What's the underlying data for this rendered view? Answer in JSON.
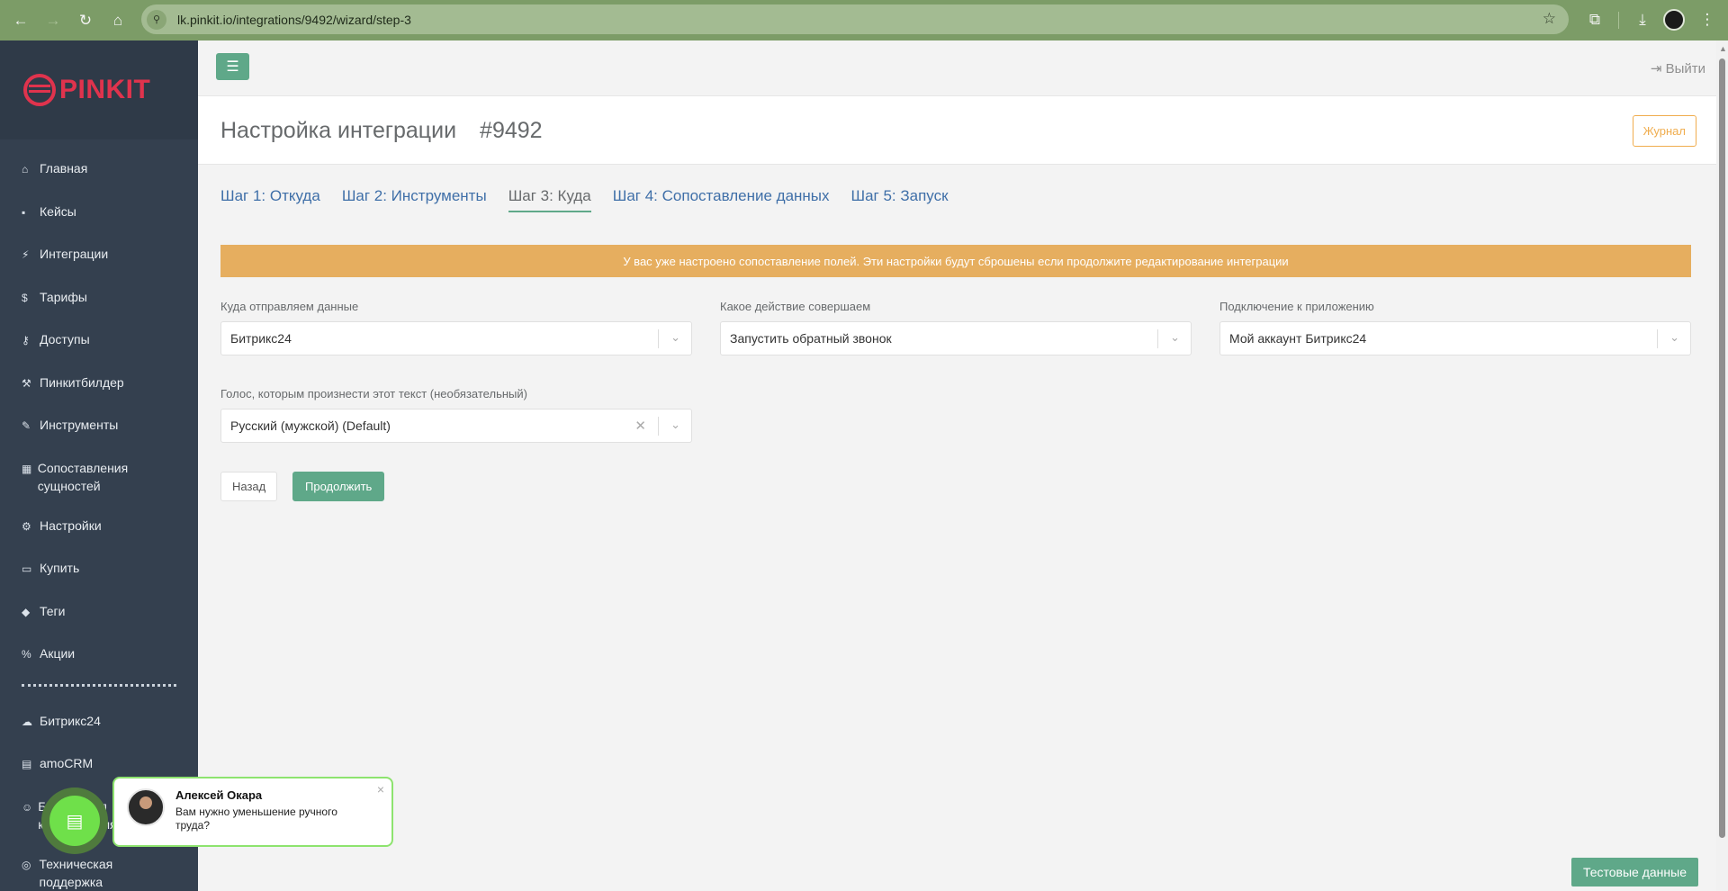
{
  "browser": {
    "url": "lk.pinkit.io/integrations/9492/wizard/step-3"
  },
  "sidebar": {
    "logo": "PINKIT",
    "items": [
      {
        "label": "Главная",
        "icon": "home-icon",
        "glyph": "⌂"
      },
      {
        "label": "Кейсы",
        "icon": "briefcase-icon",
        "glyph": "▪"
      },
      {
        "label": "Интеграции",
        "icon": "plug-icon",
        "glyph": "⚡"
      },
      {
        "label": "Тарифы",
        "icon": "dollar-icon",
        "glyph": "$"
      },
      {
        "label": "Доступы",
        "icon": "key-icon",
        "glyph": "⚷"
      },
      {
        "label": "Пинкитбилдер",
        "icon": "hammer-icon",
        "glyph": "⚒"
      },
      {
        "label": "Инструменты",
        "icon": "wrench-icon",
        "glyph": "✎"
      },
      {
        "label": "Сопоставления сущностей",
        "icon": "table-icon",
        "glyph": "▦"
      },
      {
        "label": "Настройки",
        "icon": "gears-icon",
        "glyph": "⚙"
      },
      {
        "label": "Купить",
        "icon": "money-icon",
        "glyph": "▭"
      },
      {
        "label": "Теги",
        "icon": "tags-icon",
        "glyph": "◆"
      },
      {
        "label": "Акции",
        "icon": "percent-icon",
        "glyph": "%"
      },
      {
        "label": "Битрикс24",
        "icon": "cloud-icon",
        "glyph": "☁"
      },
      {
        "label": "amoCRM",
        "icon": "amocrm-icon",
        "glyph": "▤"
      },
      {
        "label": "Бесплатная консультация",
        "icon": "user-icon",
        "glyph": "☺"
      },
      {
        "label": "Техническая поддержка",
        "icon": "support-icon",
        "glyph": "◎"
      }
    ]
  },
  "header": {
    "logout": "Выйти",
    "title": "Настройка интеграции",
    "id": "#9492",
    "journal": "Журнал"
  },
  "tabs": [
    {
      "label": "Шаг 1: Откуда",
      "active": false
    },
    {
      "label": "Шаг 2: Инструменты",
      "active": false
    },
    {
      "label": "Шаг 3: Куда",
      "active": true
    },
    {
      "label": "Шаг 4: Сопоставление данных",
      "active": false
    },
    {
      "label": "Шаг 5: Запуск",
      "active": false
    }
  ],
  "alert": "У вас уже настроено сопоставление полей. Эти настройки будут сброшены если продолжите редактирование интеграции",
  "form": {
    "destination": {
      "label": "Куда отправляем данные",
      "value": "Битрикс24"
    },
    "action": {
      "label": "Какое действие совершаем",
      "value": "Запустить обратный звонок"
    },
    "connection": {
      "label": "Подключение к приложению",
      "value": "Мой аккаунт Битрикс24"
    },
    "voice": {
      "label": "Голос, которым произнести этот текст (необязательный)",
      "value": "Русский (мужской) (Default)"
    },
    "back": "Назад",
    "next": "Продолжить"
  },
  "test_data_button": "Тестовые данные",
  "chat": {
    "name": "Алексей Окара",
    "message": "Вам нужно уменьшение ручного труда?"
  },
  "colors": {
    "accent": "#5fa889",
    "sidebar": "#34404f",
    "warning": "#e6ae5f",
    "link": "#3f6fa8",
    "logo": "#e0334d"
  }
}
